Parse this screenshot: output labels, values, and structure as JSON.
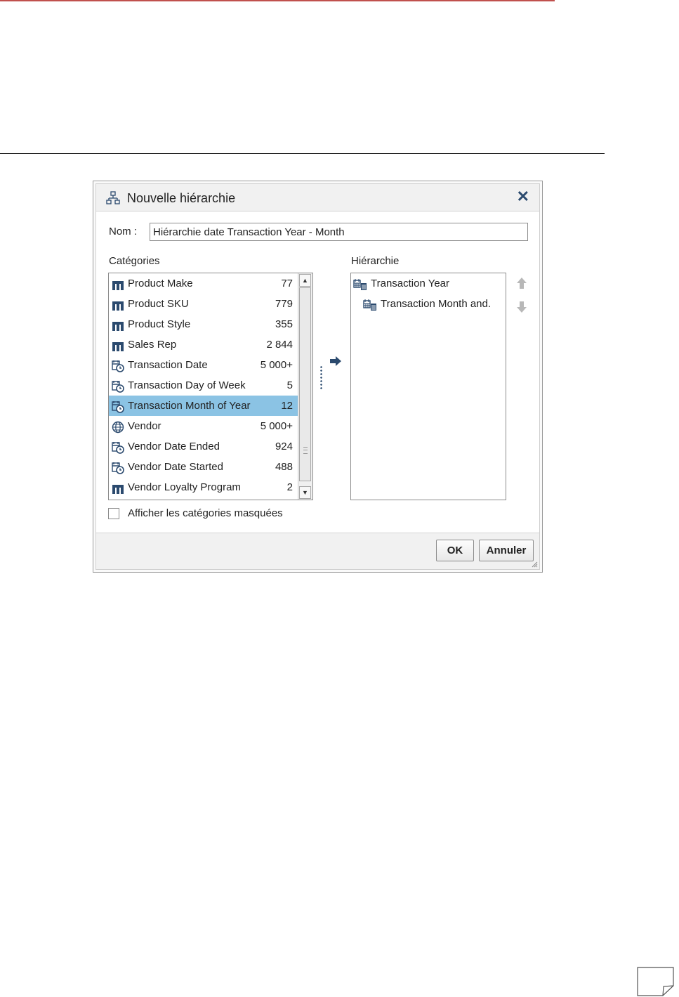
{
  "dialog": {
    "title": "Nouvelle hiérarchie",
    "name_label": "Nom :",
    "name_value": "Hiérarchie date Transaction Year - Month",
    "categories_label": "Catégories",
    "hierarchy_label": "Hiérarchie",
    "categories": [
      {
        "label": "Product Make",
        "count": "77",
        "icon": "category-icon"
      },
      {
        "label": "Product SKU",
        "count": "779",
        "icon": "category-icon"
      },
      {
        "label": "Product Style",
        "count": "355",
        "icon": "category-icon"
      },
      {
        "label": "Sales Rep",
        "count": "2 844",
        "icon": "category-icon"
      },
      {
        "label": "Transaction Date",
        "count": "5 000+",
        "icon": "date-time-icon"
      },
      {
        "label": "Transaction Day of Week",
        "count": "5",
        "icon": "date-time-icon"
      },
      {
        "label": "Transaction Month of Year",
        "count": "12",
        "icon": "date-time-icon"
      },
      {
        "label": "Vendor",
        "count": "5 000+",
        "icon": "globe-icon"
      },
      {
        "label": "Vendor Date Ended",
        "count": "924",
        "icon": "date-time-icon"
      },
      {
        "label": "Vendor Date Started",
        "count": "488",
        "icon": "date-time-icon"
      },
      {
        "label": "Vendor Loyalty Program",
        "count": "2",
        "icon": "category-icon"
      }
    ],
    "selected_category_index": 6,
    "hierarchy": [
      {
        "label": "Transaction Year",
        "level": 0,
        "icon": "calendar-icon"
      },
      {
        "label": "Transaction Month and.",
        "level": 1,
        "icon": "calendar-icon"
      }
    ],
    "show_hidden_label": "Afficher les catégories masquées",
    "show_hidden_checked": false,
    "ok_label": "OK",
    "cancel_label": "Annuler"
  },
  "colors": {
    "accent_rule": "#c0504d",
    "icon_blue": "#2b4a6e",
    "selection": "#8bc3e4"
  }
}
